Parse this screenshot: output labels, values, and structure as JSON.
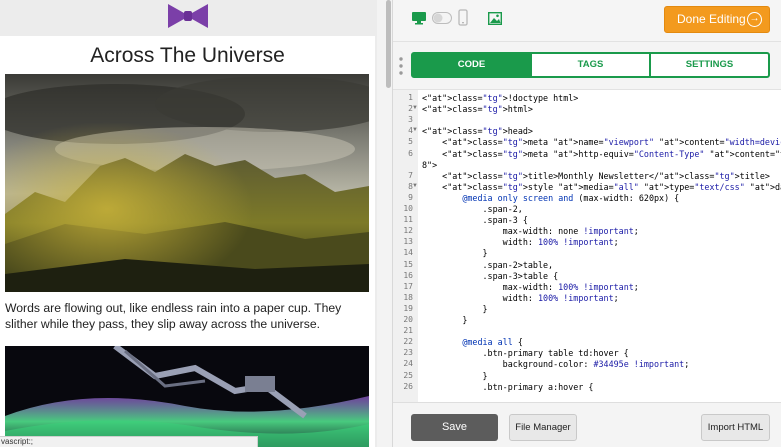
{
  "preview": {
    "title": "Across The Universe",
    "body_text": "Words are flowing out, like endless rain into a paper cup. They slither while they pass, they slip away across the universe.",
    "status_text": "vascript:;"
  },
  "toolbar": {
    "desktop_icon": "monitor-icon",
    "toggle_icon": "toggle-switch",
    "mobile_icon": "phone-icon",
    "image_icon": "image-icon",
    "done_label": "Done Editing",
    "done_icon": "arrow-circle-right-icon"
  },
  "tabs": [
    {
      "label": "CODE",
      "active": true
    },
    {
      "label": "TAGS",
      "active": false
    },
    {
      "label": "SETTINGS",
      "active": false
    }
  ],
  "code_lines": [
    {
      "n": "1",
      "text": "<!doctype html>"
    },
    {
      "n": "2",
      "text": "<html>"
    },
    {
      "n": "3",
      "text": ""
    },
    {
      "n": "4",
      "text": "<head>"
    },
    {
      "n": "5",
      "text": "    <meta name=\"viewport\" content=\"width=device-width\">"
    },
    {
      "n": "6",
      "text": "    <meta http-equiv=\"Content-Type\" content=\"text/html; charset=UTF-"
    },
    {
      "n": "",
      "text": "8\">"
    },
    {
      "n": "7",
      "text": "    <title>Monthly Newsletter</title>"
    },
    {
      "n": "8",
      "text": "    <style media=\"all\" type=\"text/css\" data-embed=\"\">"
    },
    {
      "n": "9",
      "text": "        @media only screen and (max-width: 620px) {"
    },
    {
      "n": "10",
      "text": "            .span-2,"
    },
    {
      "n": "11",
      "text": "            .span-3 {"
    },
    {
      "n": "12",
      "text": "                max-width: none !important;"
    },
    {
      "n": "13",
      "text": "                width: 100% !important;"
    },
    {
      "n": "14",
      "text": "            }"
    },
    {
      "n": "15",
      "text": "            .span-2>table,"
    },
    {
      "n": "16",
      "text": "            .span-3>table {"
    },
    {
      "n": "17",
      "text": "                max-width: 100% !important;"
    },
    {
      "n": "18",
      "text": "                width: 100% !important;"
    },
    {
      "n": "19",
      "text": "            }"
    },
    {
      "n": "20",
      "text": "        }"
    },
    {
      "n": "21",
      "text": ""
    },
    {
      "n": "22",
      "text": "        @media all {"
    },
    {
      "n": "23",
      "text": "            .btn-primary table td:hover {"
    },
    {
      "n": "24",
      "text": "                background-color: #34495e !important;"
    },
    {
      "n": "25",
      "text": "            }"
    },
    {
      "n": "26",
      "text": "            .btn-primary a:hover {"
    }
  ],
  "fold_lines": [
    "2",
    "4",
    "8"
  ],
  "bottom": {
    "save_label": "Save",
    "file_manager_label": "File Manager",
    "import_label": "Import HTML"
  },
  "colors": {
    "accent_orange": "#f39a1e",
    "accent_green": "#1a9a4b",
    "logo_purple": "#7b3fa8",
    "save_button": "#5c5c5c"
  }
}
